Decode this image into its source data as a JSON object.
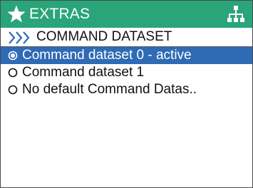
{
  "header": {
    "title": "EXTRAS",
    "left_icon": "star-icon",
    "right_icon": "network-icon",
    "bg_color": "#2aa57a"
  },
  "breadcrumb": {
    "icon": "triple-chevron-right-icon",
    "label": "COMMAND DATASET"
  },
  "options": [
    {
      "label": "Command dataset 0 - active",
      "selected": true
    },
    {
      "label": "Command dataset 1",
      "selected": false
    },
    {
      "label": "No default Command Datas..",
      "selected": false
    }
  ],
  "colors": {
    "selection": "#2f6ab5",
    "accent": "#2aa57a"
  }
}
